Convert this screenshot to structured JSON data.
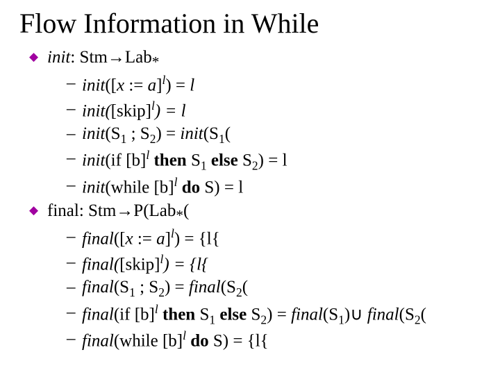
{
  "title": "Flow Information in While",
  "bullet1": {
    "head_pre": "init",
    "head_post": ": Stm→Lab",
    "head_sub": "*",
    "items": {
      "a_pre": "init",
      "a_mid1": "([",
      "a_x": "x",
      "a_mid2": " := ",
      "a_a": "a",
      "a_mid3": "]",
      "a_sup": "l",
      "a_mid4": ") = ",
      "a_end": "l",
      "b_pre": "init(",
      "b_skip": "[skip]",
      "b_sup": "l",
      "b_mid": ") = ",
      "b_end": "l",
      "c_pre": "init",
      "c_mid1": "(S",
      "c_s1": "1",
      "c_mid2": " ; S",
      "c_s2": "2",
      "c_mid3": ") = ",
      "c_post": "init",
      "c_mid4": "(S",
      "c_s3": "1",
      "c_tail": "(",
      "d_pre": "init",
      "d_mid1": "(if [b]",
      "d_sup": "l",
      "d_mid2": " then",
      "d_mid3": " S",
      "d_s1": "1",
      "d_mid4": " else",
      "d_mid5": " S",
      "d_s2": "2",
      "d_mid6": ") = l",
      "e_pre": "init",
      "e_mid1": "(while [b]",
      "e_sup": "l",
      "e_mid2": " do",
      "e_mid3": " S) = l"
    }
  },
  "bullet2": {
    "head": "final: Stm→P(Lab",
    "head_sub": "*",
    "head_tail": "(",
    "items": {
      "a_pre": "final",
      "a_mid1": "([",
      "a_x": "x",
      "a_mid2": " := ",
      "a_a": "a",
      "a_mid3": "]",
      "a_sup": "l",
      "a_mid4": ") = {l{",
      "b_pre": "final(",
      "b_skip": "[skip]",
      "b_sup": "l",
      "b_mid": ") = {l{",
      "c_pre": "final",
      "c_mid1": "(S",
      "c_s1": "1",
      "c_mid2": " ; S",
      "c_s2": "2",
      "c_mid3": ") = ",
      "c_post": "final",
      "c_mid4": "(S",
      "c_s3": "2",
      "c_tail": "(",
      "d_pre": "final",
      "d_mid1": "(if [b]",
      "d_sup": "l",
      "d_mid2": " then",
      "d_mid3": " S",
      "d_s1": "1",
      "d_mid4": " else",
      "d_mid5": " S",
      "d_s2": "2",
      "d_mid6": ") = ",
      "d_post1": "final",
      "d_mid7": "(S",
      "d_s3": "1",
      "d_mid8": ")∪ ",
      "d_post2": "final",
      "d_mid9": "(S",
      "d_s4": "2",
      "d_tail": "(",
      "e_pre": "final",
      "e_mid1": "(while [b]",
      "e_sup": "l",
      "e_mid2": " do",
      "e_mid3": " S) = {l{"
    }
  }
}
